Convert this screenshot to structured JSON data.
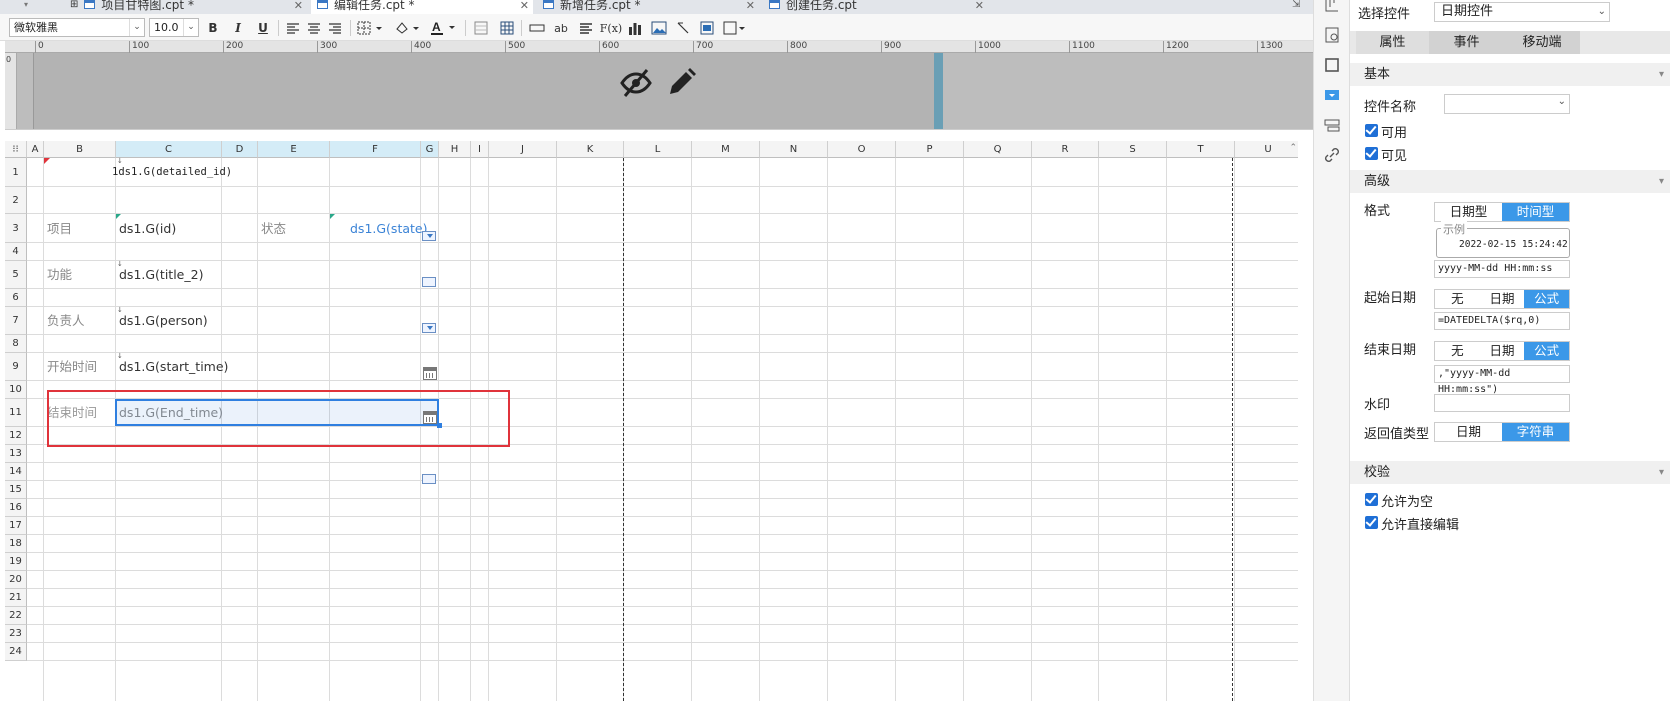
{
  "tabs": [
    {
      "label": "项目甘特图.cpt *",
      "active": false
    },
    {
      "label": "编辑任务.cpt *",
      "active": true
    },
    {
      "label": "新增任务.cpt *",
      "active": false
    },
    {
      "label": "创建任务.cpt",
      "active": false
    }
  ],
  "toolbar": {
    "font_family": "微软雅黑",
    "font_size": "10.0",
    "bold": "B",
    "italic": "I",
    "underline": "U",
    "text_label": "ab",
    "formula": "F(x)"
  },
  "ruler": {
    "ticks": [
      "0",
      "100",
      "200",
      "300",
      "400",
      "500",
      "600",
      "700",
      "800",
      "900",
      "1000",
      "1100",
      "1200",
      "1300"
    ],
    "vertical": "0"
  },
  "sheet": {
    "columns": [
      "A",
      "B",
      "C",
      "D",
      "E",
      "F",
      "G",
      "H",
      "I",
      "J",
      "K",
      "L",
      "M",
      "N",
      "O",
      "P",
      "Q",
      "R",
      "S",
      "T",
      "U"
    ],
    "rows": [
      "1",
      "2",
      "3",
      "4",
      "5",
      "6",
      "7",
      "8",
      "9",
      "10",
      "11",
      "12",
      "13",
      "14",
      "15",
      "16",
      "17",
      "18",
      "19",
      "20",
      "21",
      "22",
      "23",
      "24"
    ],
    "cells": {
      "c1": "1ds1.G(detailed_id)",
      "b3": "项目",
      "c3": "ds1.G(id)",
      "e3": "状态",
      "f3": "ds1.G(state)",
      "b5": "功能",
      "c5": "ds1.G(title_2)",
      "b7": "负责人",
      "c7": "ds1.G(person)",
      "b9": "开始时间",
      "c9": "ds1.G(start_time)",
      "b11": "结束时间",
      "c11": "ds1.G(End_time)"
    }
  },
  "panel": {
    "select_widget_label": "选择控件",
    "select_widget_value": "日期控件",
    "tabs": [
      "属性",
      "事件",
      "移动端"
    ],
    "section_basic": "基本",
    "widget_name_label": "控件名称",
    "widget_name_value": "",
    "enabled_label": "可用",
    "visible_label": "可见",
    "section_advanced": "高级",
    "format_label": "格式",
    "format_options": [
      "日期型",
      "时间型"
    ],
    "format_selected": "时间型",
    "example_label": "示例",
    "example_value": "2022-02-15 15:24:42",
    "format_pattern": "yyyy-MM-dd HH:mm:ss",
    "start_date_label": "起始日期",
    "start_date_options": [
      "无",
      "日期",
      "公式"
    ],
    "start_date_selected": "公式",
    "start_date_formula": "=DATEDELTA($rq,0)",
    "end_date_label": "结束日期",
    "end_date_options": [
      "无",
      "日期",
      "公式"
    ],
    "end_date_selected": "公式",
    "end_date_formula": ",\"yyyy-MM-dd HH:mm:ss\")",
    "watermark_label": "水印",
    "watermark_value": "",
    "return_type_label": "返回值类型",
    "return_type_options": [
      "日期",
      "字符串"
    ],
    "return_type_selected": "字符串",
    "section_validation": "校验",
    "allow_empty_label": "允许为空",
    "allow_direct_edit_label": "允许直接编辑"
  },
  "colors": {
    "accent": "#3b98e8",
    "highlight_box": "#e0333b",
    "selected_cell": "#2f7fe0"
  }
}
